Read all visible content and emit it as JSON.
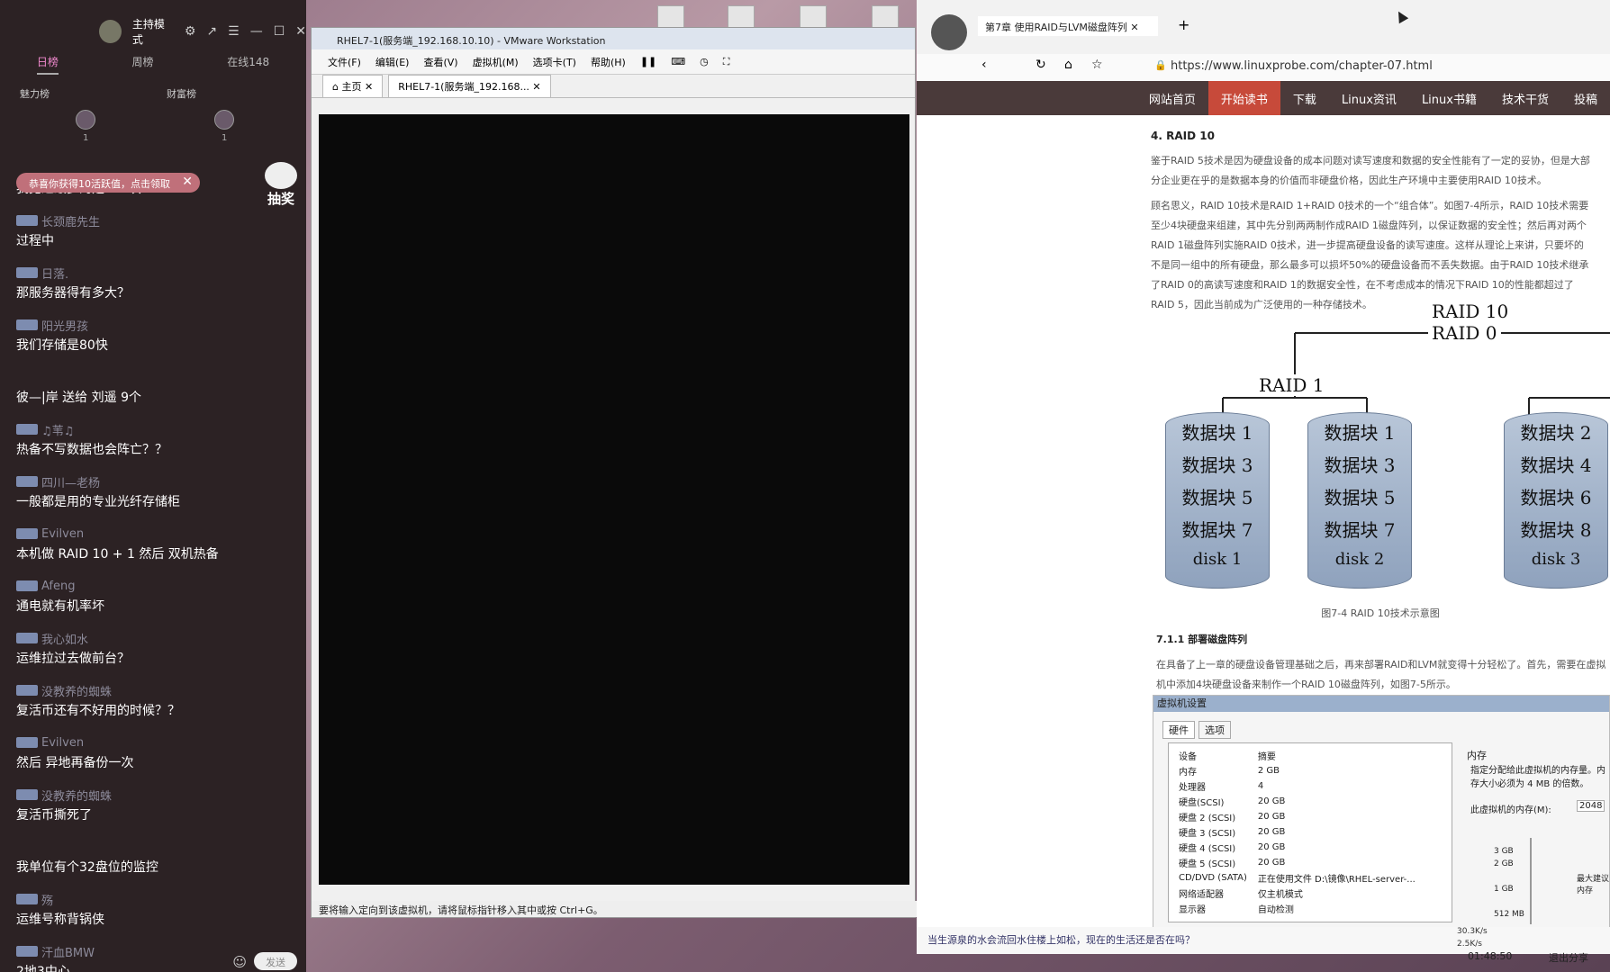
{
  "chat": {
    "mode": "主持模式",
    "tabs": [
      "日榜",
      "周榜",
      "在线148"
    ],
    "ranks": [
      "魅力榜",
      "财富榜"
    ],
    "rank_counts": [
      "1",
      "1"
    ],
    "notice": "恭喜你获得10活跃值，点击领取",
    "lottery": "抽奖",
    "messages": [
      {
        "name": "",
        "text": "我见过最多的是192块"
      },
      {
        "name": "长颈鹿先生",
        "text": "过程中"
      },
      {
        "name": "日落.",
        "text": "那服务器得有多大？"
      },
      {
        "name": "阳光男孩",
        "text": "我们存储是80快"
      },
      {
        "name": "",
        "text": "彼—|岸 送给 刘遥 9个"
      },
      {
        "name": "♫苇♫",
        "text": "热备不写数据也会阵亡？？"
      },
      {
        "name": "四川—老杨",
        "text": "一般都是用的专业光纤存储柜"
      },
      {
        "name": "Evilven",
        "text": "本机做 RAID 10 + 1  然后 双机热备"
      },
      {
        "name": "Afeng",
        "text": "通电就有机率坏"
      },
      {
        "name": "我心如水",
        "text": "运维拉过去做前台？"
      },
      {
        "name": "没教养的蜘蛛",
        "text": "复活币还有不好用的时候？？"
      },
      {
        "name": "Evilven",
        "text": "然后 异地再备份一次"
      },
      {
        "name": "没教养的蜘蛛",
        "text": "复活币撕死了"
      },
      {
        "name": "",
        "text": "我单位有个32盘位的监控"
      },
      {
        "name": "殇",
        "text": "运维号称背锅侠"
      },
      {
        "name": "汗血BMW",
        "text": "2地3中心"
      }
    ],
    "send": "发送"
  },
  "vm": {
    "title": "RHEL7-1(服务端_192.168.10.10) - VMware Workstation",
    "menu": [
      "文件(F)",
      "编辑(E)",
      "查看(V)",
      "虚拟机(M)",
      "选项卡(T)",
      "帮助(H)"
    ],
    "tabs": [
      "主页",
      "RHEL7-1(服务端_192.168..."
    ],
    "status": "要将输入定向到该虚拟机，请将鼠标指针移入其中或按 Ctrl+G。"
  },
  "browser": {
    "tab": "第7章 使用RAID与LVM磁盘阵列",
    "url": "https://www.linuxprobe.com/chapter-07.html",
    "nav": [
      "网站首页",
      "开始读书",
      "下载",
      "Linux资讯",
      "Linux书籍",
      "技术干货",
      "投稿"
    ],
    "heading": "4. RAID 10",
    "para1": "鉴于RAID 5技术是因为硬盘设备的成本问题对读写速度和数据的安全性能有了一定的妥协，但是大部分企业更在乎的是数据本身的价值而非硬盘价格，因此生产环境中主要使用RAID 10技术。",
    "para2": "顾名思义，RAID 10技术是RAID 1+RAID 0技术的一个“组合体”。如图7-4所示，RAID 10技术需要至少4块硬盘来组建，其中先分别两两制作成RAID 1磁盘阵列，以保证数据的安全性；然后再对两个RAID 1磁盘阵列实施RAID 0技术，进一步提高硬盘设备的读写速度。这样从理论上来讲，只要坏的不是同一组中的所有硬盘，那么最多可以损坏50%的硬盘设备而不丢失数据。由于RAID 10技术继承了RAID 0的高读写速度和RAID 1的数据安全性，在不考虑成本的情况下RAID 10的性能都超过了RAID 5，因此当前成为广泛使用的一种存储技术。",
    "raid10": "RAID 10",
    "raid0": "RAID 0",
    "raid1": "RAID 1",
    "disks": [
      {
        "blocks": [
          "数据块 1",
          "数据块 3",
          "数据块 5",
          "数据块 7"
        ],
        "label": "disk 1"
      },
      {
        "blocks": [
          "数据块 1",
          "数据块 3",
          "数据块 5",
          "数据块 7"
        ],
        "label": "disk 2"
      },
      {
        "blocks": [
          "数据块 2",
          "数据块 4",
          "数据块 6",
          "数据块 8"
        ],
        "label": "disk 3"
      }
    ],
    "caption": "图7-4  RAID 10技术示意图",
    "section": "7.1.1  部署磁盘阵列",
    "para3": "在具备了上一章的硬盘设备管理基础之后，再来部署RAID和LVM就变得十分轻松了。首先，需要在虚拟机中添加4块硬盘设备来制作一个RAID 10磁盘阵列，如图7-5所示。",
    "vmset": {
      "title": "虚拟机设置",
      "tabs": [
        "硬件",
        "选项"
      ],
      "headers": [
        "设备",
        "摘要"
      ],
      "rows": [
        [
          "内存",
          "2 GB"
        ],
        [
          "处理器",
          "4"
        ],
        [
          "硬盘(SCSI)",
          "20 GB"
        ],
        [
          "硬盘 2 (SCSI)",
          "20 GB"
        ],
        [
          "硬盘 3 (SCSI)",
          "20 GB"
        ],
        [
          "硬盘 4 (SCSI)",
          "20 GB"
        ],
        [
          "硬盘 5 (SCSI)",
          "20 GB"
        ],
        [
          "CD/DVD (SATA)",
          "正在使用文件 D:\\镜像\\RHEL-server-..."
        ],
        [
          "网络适配器",
          "仅主机模式"
        ],
        [
          "显示器",
          "自动检测"
        ]
      ],
      "mem_title": "内存",
      "mem_desc": "指定分配给此虚拟机的内存量。内存大小必须为 4 MB 的倍数。",
      "mem_label": "此虚拟机的内存(M):",
      "mem_value": "2048",
      "scale": [
        "3 GB",
        "2 GB",
        "1 GB",
        "512 MB"
      ],
      "max": "最大建议内存"
    },
    "status": "当生源泉的水会流回水住楼上如松，现在的生活还是否在吗？",
    "speed_up": "30.3K/s",
    "speed_down": "2.5K/s",
    "time": "01:48:50",
    "share": "退出分享"
  }
}
